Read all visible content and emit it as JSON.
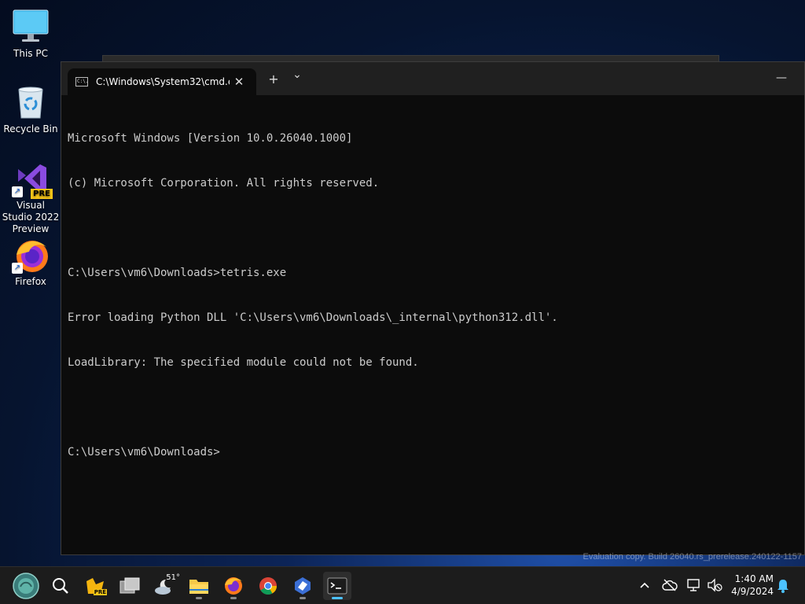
{
  "desktop": {
    "icons": [
      {
        "label": "This PC"
      },
      {
        "label": "Recycle Bin"
      },
      {
        "label": "Visual Studio 2022 Preview",
        "badge": "PRE"
      },
      {
        "label": "Firefox"
      }
    ]
  },
  "terminal": {
    "tab_title": "C:\\Windows\\System32\\cmd.e",
    "tab_icon_text": "C:\\.",
    "new_tab": "+",
    "dropdown": "⌄",
    "close": "✕",
    "minimize": "—",
    "lines": [
      "Microsoft Windows [Version 10.0.26040.1000]",
      "(c) Microsoft Corporation. All rights reserved.",
      "",
      "C:\\Users\\vm6\\Downloads>tetris.exe",
      "Error loading Python DLL 'C:\\Users\\vm6\\Downloads\\_internal\\python312.dll'.",
      "LoadLibrary: The specified module could not be found.",
      "",
      "C:\\Users\\vm6\\Downloads>"
    ]
  },
  "watermark": "Evaluation copy. Build 26040.rs_prerelease.240122-1157",
  "taskbar": {
    "weather_temp": "51°",
    "pre_badge": "PRE",
    "clock_time": "1:40 AM",
    "clock_date": "4/9/2024"
  },
  "icons": {
    "start": "start-icon",
    "search": "search-icon",
    "task_view": "task-view-icon",
    "weather": "weather-icon",
    "explorer": "file-explorer-icon",
    "firefox": "firefox-icon",
    "chrome": "chrome-icon",
    "terminal": "terminal-icon"
  },
  "colors": {
    "console_bg": "#0c0c0c",
    "console_fg": "#cccccc",
    "titlebar": "#202020",
    "taskbar": "#1c1c1c",
    "accent": "#4cc2ff"
  }
}
